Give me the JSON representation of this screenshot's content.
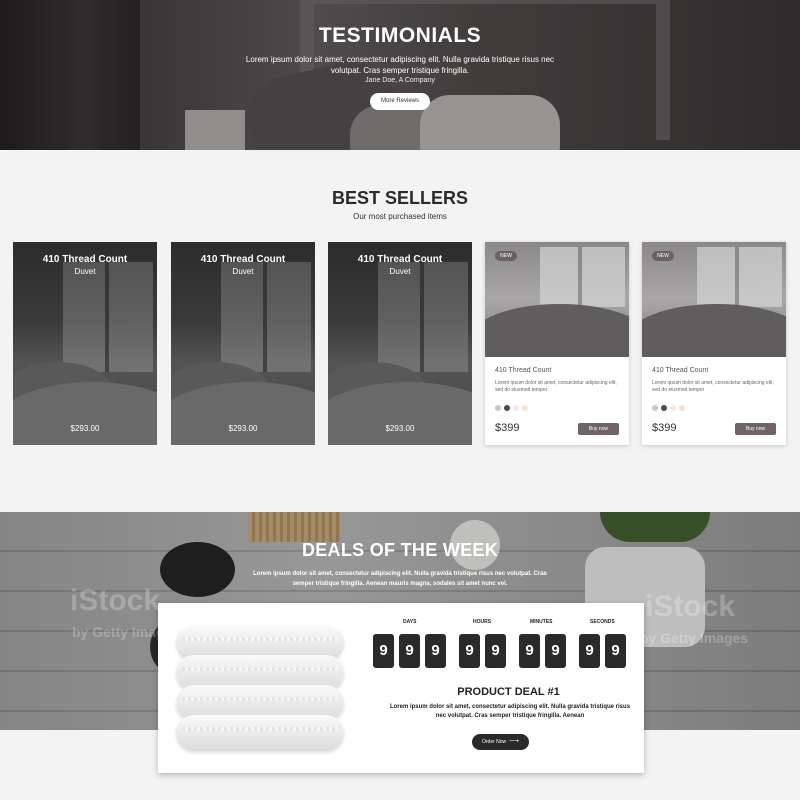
{
  "testimonials": {
    "title": "TESTIMONIALS",
    "text": "Lorem ipsum dolor sit amet, consectetur adipiscing elit. Nulla gravida tristique risus nec volutpat. Cras semper tristique fringilla.",
    "author": "Jane Doe, A Company",
    "button": "More Reviews"
  },
  "best_sellers": {
    "title": "BEST SELLERS",
    "subtitle": "Our most purchased items",
    "dark_cards": [
      {
        "title": "410 Thread Count",
        "subtitle": "Duvet",
        "price": "$293.00"
      },
      {
        "title": "410 Thread Count",
        "subtitle": "Duvet",
        "price": "$293.00"
      },
      {
        "title": "410 Thread Count",
        "subtitle": "Duvet",
        "price": "$293.00"
      }
    ],
    "light_cards": [
      {
        "badge": "NEW",
        "title": "410 Thread Count",
        "description": "Lorem ipsum dolor sit amet, consectetur adipiscing elit, sed do eiusmod tempor",
        "price": "$399",
        "button": "Buy now",
        "swatches": [
          "#c7c7c7",
          "#4a4a4a",
          "#f2ece6",
          "#f3e3cf"
        ]
      },
      {
        "badge": "NEW",
        "title": "410 Thread Count",
        "description": "Lorem ipsum dolor sit amet, consectetur adipiscing elit, sed do eiusmod tempor",
        "price": "$399",
        "button": "Buy now",
        "swatches": [
          "#c7c7c7",
          "#4a4a4a",
          "#f2ece6",
          "#f3e3cf"
        ]
      }
    ]
  },
  "deals": {
    "title": "DEALS OF THE WEEK",
    "text": "Lorem ipsum dolor sit amet, consectetur adipiscing elit. Nulla gravida tristique risus nec volutpat. Cras semper tristique fringilla. Aenean mauris magna, sodales sit amet nunc vel.",
    "watermarks": [
      "iStock",
      "by Getty Images",
      "iStock",
      "by Getty Images"
    ],
    "countdown": {
      "days_label": "DAYS",
      "days": [
        "9",
        "9",
        "9"
      ],
      "hours_label": "HOURS",
      "hours": [
        "9",
        "9"
      ],
      "minutes_label": "MINUTES",
      "minutes": [
        "9",
        "9"
      ],
      "seconds_label": "SECONDS",
      "seconds": [
        "9",
        "9"
      ]
    },
    "product_name": "PRODUCT DEAL #1",
    "product_desc": "Lorem ipsum dolor sit amet, consectetur adipiscing elit. Nulla gravida tristique risus nec volutpat. Cras semper tristique fringilla. Aenean",
    "order_button": "Order Now",
    "order_icon": "arrow-right-icon"
  },
  "colors": {
    "buy_button": "#6f6365",
    "badge": "#6b6163",
    "dark_button": "#2a2a2a"
  }
}
